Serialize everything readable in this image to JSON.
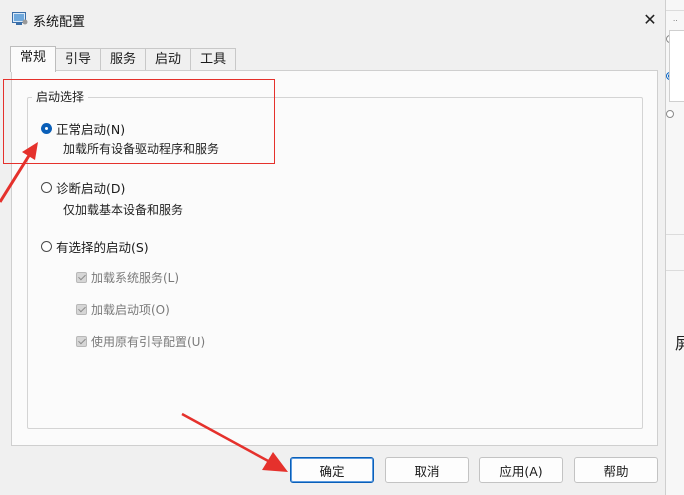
{
  "window": {
    "title": "系统配置",
    "close_glyph": "✕"
  },
  "tabs": [
    {
      "label": "常规",
      "active": true
    },
    {
      "label": "引导",
      "active": false
    },
    {
      "label": "服务",
      "active": false
    },
    {
      "label": "启动",
      "active": false
    },
    {
      "label": "工具",
      "active": false
    }
  ],
  "startup": {
    "group_label": "启动选择",
    "normal": {
      "label": "正常启动(N)",
      "desc": "加载所有设备驱动程序和服务",
      "checked": true
    },
    "diagnostic": {
      "label": "诊断启动(D)",
      "desc": "仅加载基本设备和服务",
      "checked": false
    },
    "selective": {
      "label": "有选择的启动(S)",
      "checked": false,
      "options": [
        {
          "label": "加载系统服务(L)",
          "checked": true,
          "disabled": true
        },
        {
          "label": "加载启动项(O)",
          "checked": true,
          "disabled": true
        },
        {
          "label": "使用原有引导配置(U)",
          "checked": true,
          "disabled": true
        }
      ]
    }
  },
  "buttons": {
    "ok": "确定",
    "cancel": "取消",
    "apply": "应用(A)",
    "help": "帮助"
  },
  "background_window": {
    "glyph": "屏"
  },
  "colors": {
    "accent": "#0a5fb8",
    "annotation": "#e5312c"
  }
}
